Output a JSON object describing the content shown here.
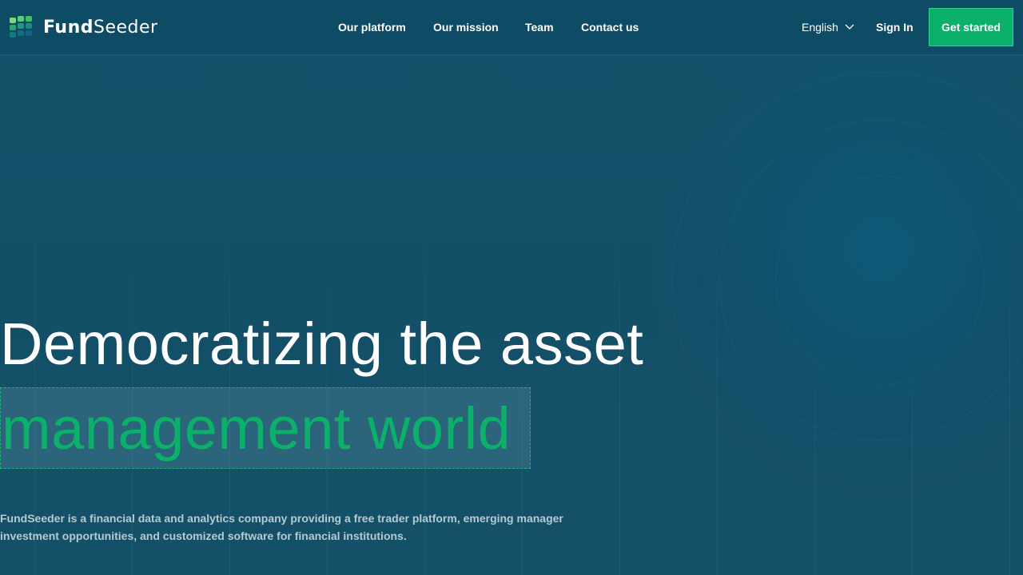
{
  "brand": {
    "name_part1": "Fund",
    "name_part2": "Seeder"
  },
  "nav": {
    "items": [
      {
        "label": "Our platform"
      },
      {
        "label": "Our mission"
      },
      {
        "label": "Team"
      },
      {
        "label": "Contact us"
      }
    ]
  },
  "header_actions": {
    "language": "English",
    "sign_in": "Sign In",
    "get_started": "Get started"
  },
  "hero": {
    "title_line1": "Democratizing the asset",
    "title_line2": "management world",
    "description": "FundSeeder is a financial data and analytics company providing a free trader platform, emerging manager investment opportunities, and customized software for financial institutions."
  },
  "colors": {
    "background": "#144f68",
    "header": "#0e4b64",
    "accent": "#0bb06a",
    "text": "#ffffff",
    "muted_text": "#b7c9d1"
  },
  "icons": {
    "logo": "fundseeder-logo-mark",
    "language_dropdown": "chevron-down-icon"
  }
}
